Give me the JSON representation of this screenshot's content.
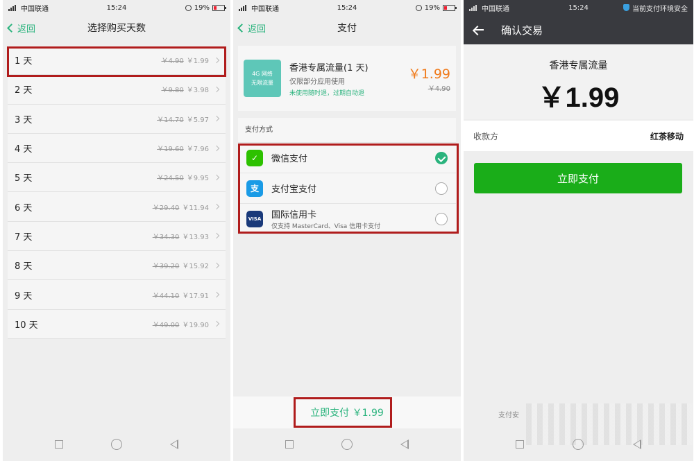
{
  "status": {
    "carrier": "中国联通",
    "time": "15:24",
    "battery": "19%",
    "secure_text": "当前支付环境安全"
  },
  "panel1": {
    "back_label": "返回",
    "title": "选择购买天数",
    "days": [
      {
        "label": "1 天",
        "old_price": "￥4.90",
        "price": "￥1.99"
      },
      {
        "label": "2 天",
        "old_price": "￥9.80",
        "price": "￥3.98"
      },
      {
        "label": "3 天",
        "old_price": "￥14.70",
        "price": "￥5.97"
      },
      {
        "label": "4 天",
        "old_price": "￥19.60",
        "price": "￥7.96"
      },
      {
        "label": "5 天",
        "old_price": "￥24.50",
        "price": "￥9.95"
      },
      {
        "label": "6 天",
        "old_price": "￥29.40",
        "price": "￥11.94"
      },
      {
        "label": "7 天",
        "old_price": "￥34.30",
        "price": "￥13.93"
      },
      {
        "label": "8 天",
        "old_price": "￥39.20",
        "price": "￥15.92"
      },
      {
        "label": "9 天",
        "old_price": "￥44.10",
        "price": "￥17.91"
      },
      {
        "label": "10 天",
        "old_price": "￥49.00",
        "price": "￥19.90"
      }
    ]
  },
  "panel2": {
    "back_label": "返回",
    "title": "支付",
    "product": {
      "icon_line1": "4G 网络",
      "icon_line2": "无限流量",
      "name": "香港专属流量(1 天)",
      "subtitle": "仅限部分应用使用",
      "note": "未使用随时退，过期自动退",
      "price": "￥1.99",
      "old_price": "￥4.90"
    },
    "pay_methods_title": "支付方式",
    "methods": [
      {
        "name": "微信支付",
        "sub": "",
        "icon": "wechat-pay-icon",
        "color": "#2dc100",
        "selected": true
      },
      {
        "name": "支付宝支付",
        "sub": "",
        "icon": "alipay-icon",
        "color": "#1a9be6",
        "selected": false
      },
      {
        "name": "国际信用卡",
        "sub": "仅支持 MasterCard、Visa 信用卡支付",
        "icon": "visa-icon",
        "color": "#1a3a7a",
        "selected": false
      }
    ],
    "pay_button": "立即支付 ￥1.99"
  },
  "panel3": {
    "title": "确认交易",
    "product_name": "香港专属流量",
    "amount": "￥1.99",
    "payee_label": "收款方",
    "payee_value": "红茶移动",
    "pay_button": "立即支付",
    "footer": "支付安"
  },
  "colors": {
    "accent_green": "#2ab37d",
    "price_orange": "#f07a1a",
    "wechat_green": "#1aad19",
    "highlight_red": "#b01c1c"
  }
}
